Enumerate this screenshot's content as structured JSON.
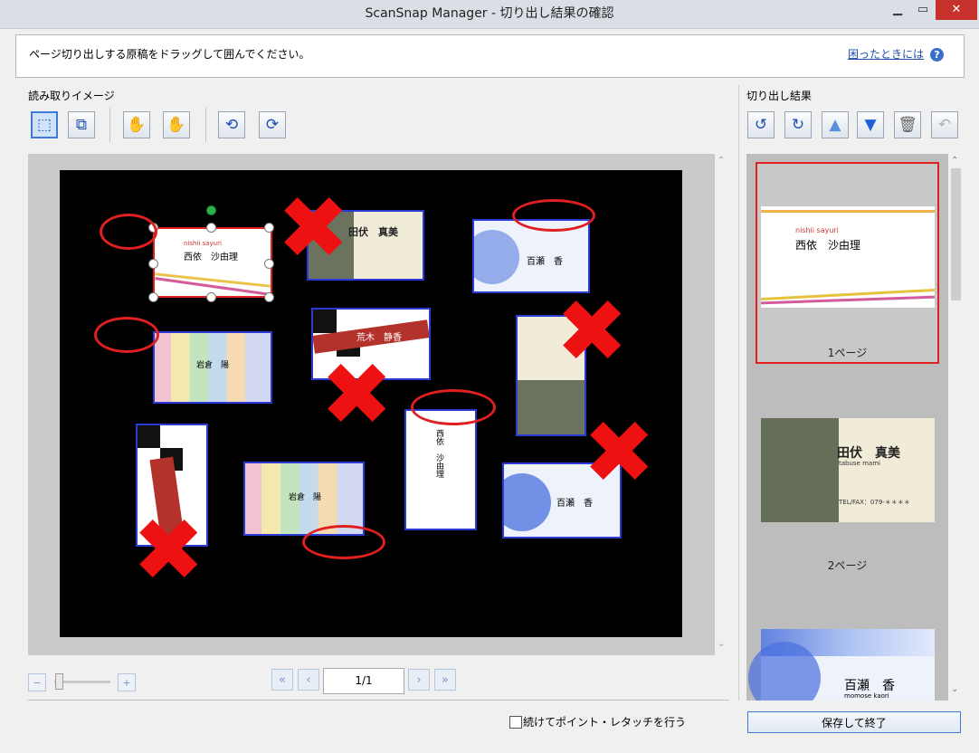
{
  "window": {
    "title": "ScanSnap Manager - 切り出し結果の確認",
    "min_icon": "minimize-icon",
    "max_icon": "maximize-icon",
    "close_icon": "close-icon"
  },
  "instruction": {
    "text": "ページ切り出しする原稿をドラッグして囲んでください。",
    "help_link": "困ったときには",
    "help_icon": "?"
  },
  "left_panel": {
    "label": "読み取りイメージ",
    "toolbar": [
      "select-area-tool",
      "select-next-tool",
      "hand-disabled-tool",
      "hand-tool",
      "rotate-left-tool",
      "rotate-right-tool"
    ],
    "cards": [
      {
        "top_name": "nishii sayuri",
        "name": "西依　沙由理"
      },
      {
        "name": "田伏　真美"
      },
      {
        "name": "百瀬　香"
      },
      {
        "name": "荒木　静香"
      },
      {
        "name": "岩倉　陽"
      },
      {
        "name": "荒木　静香"
      },
      {
        "name": "百瀬　香"
      }
    ]
  },
  "navigation": {
    "page": "1/1"
  },
  "right_panel": {
    "label": "切り出し結果",
    "pages": [
      {
        "name_roman": "nishii sayuri",
        "name": "西依　沙由理",
        "label": "1ページ",
        "selected": true
      },
      {
        "name_roman": "tabuse mami",
        "name": "田伏　真美",
        "telfax": "TEL/FAX：079-＊＊＊＊",
        "label": "2ページ"
      },
      {
        "name_roman": "momose kaori",
        "name": "百瀬　香",
        "label": ""
      }
    ]
  },
  "footer": {
    "checkbox_label": "続けてポイント・レタッチを行う",
    "checkbox_checked": false,
    "save_button": "保存して終了"
  },
  "colors": {
    "accent": "#3d7bd6",
    "mark_red": "#e11111",
    "card_border": "#2a3ad4"
  }
}
